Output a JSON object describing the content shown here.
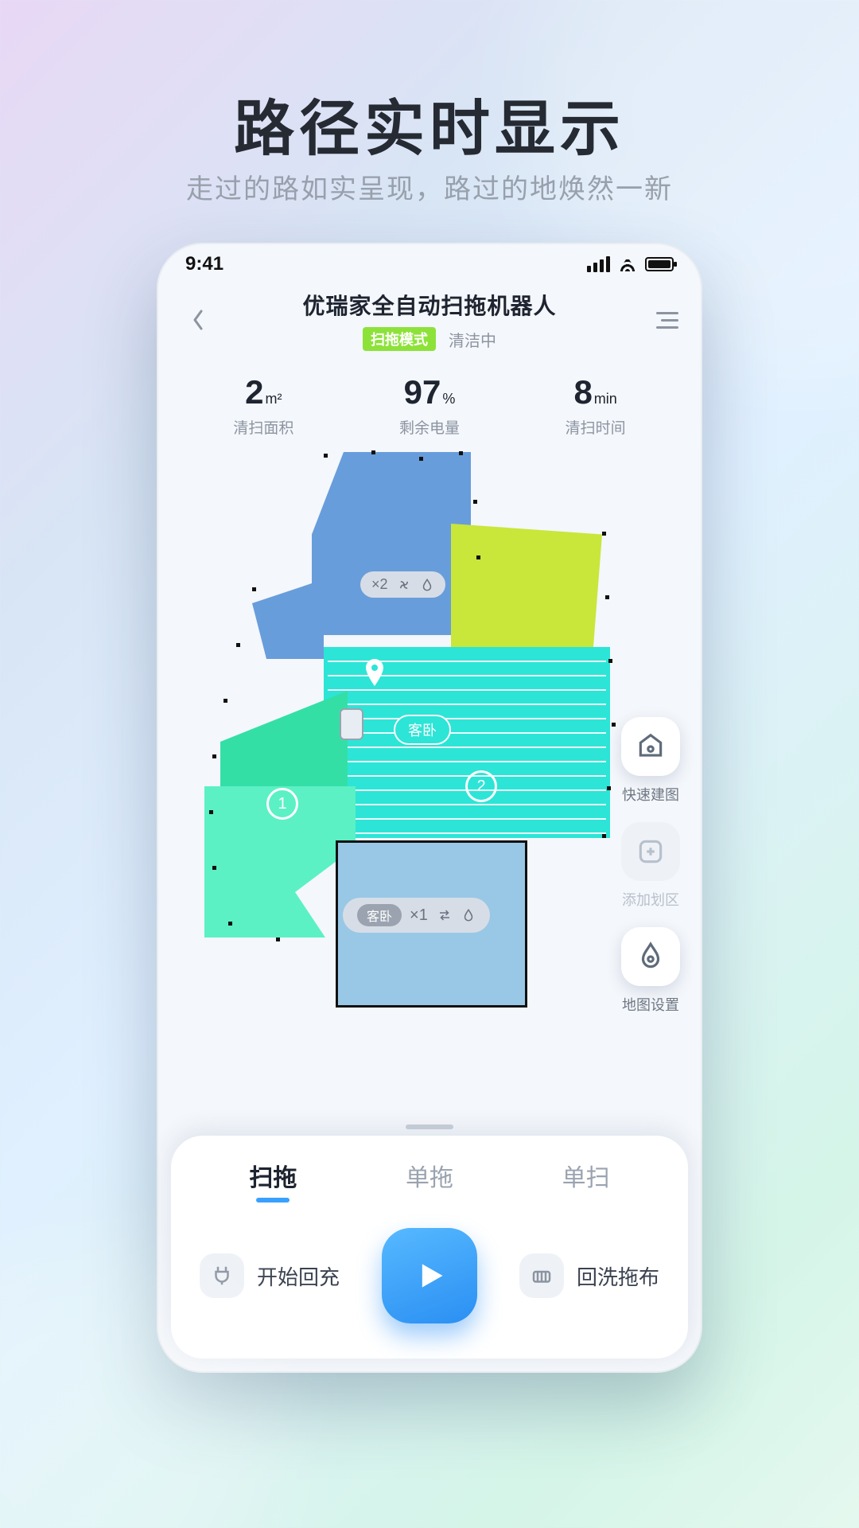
{
  "hero": {
    "title": "路径实时显示",
    "subtitle": "走过的路如实呈现，路过的地焕然一新"
  },
  "status": {
    "time": "9:41"
  },
  "device": {
    "name": "优瑞家全自动扫拖机器人",
    "mode_badge": "扫拖模式",
    "state": "清洁中"
  },
  "stats": {
    "area": {
      "value": "2",
      "unit": "m²",
      "label": "清扫面积"
    },
    "battery": {
      "value": "97",
      "unit": "%",
      "label": "剩余电量"
    },
    "time": {
      "value": "8",
      "unit": "min",
      "label": "清扫时间"
    }
  },
  "map": {
    "bubble_top": {
      "text": "×2"
    },
    "room_pill": "客卧",
    "bubble_bottom": {
      "room": "客卧",
      "text": "×1"
    },
    "pin1": "1",
    "pin2": "2"
  },
  "side_buttons": {
    "quick_map": "快速建图",
    "add_zone": "添加划区",
    "map_set": "地图设置"
  },
  "tabs": {
    "t1": "扫拖",
    "t2": "单拖",
    "t3": "单扫"
  },
  "bottom_actions": {
    "recharge": "开始回充",
    "wash": "回洗拖布"
  }
}
